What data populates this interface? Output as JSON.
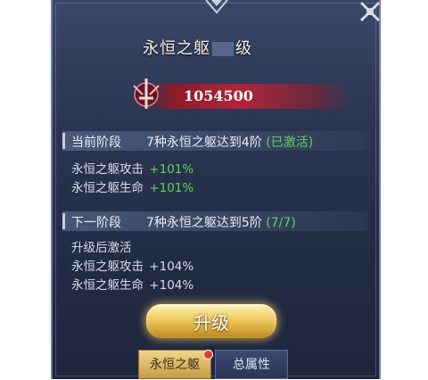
{
  "dialog": {
    "title_left": "永恒之躯",
    "title_right": "级"
  },
  "power": {
    "value": "1054500"
  },
  "current_stage": {
    "label": "当前阶段",
    "desc": "7种永恒之躯达到4阶",
    "status": "(已激活)",
    "stats": [
      {
        "name": "永恒之躯攻击",
        "value": "+101%"
      },
      {
        "name": "永恒之躯生命",
        "value": "+101%"
      }
    ]
  },
  "next_stage": {
    "label": "下一阶段",
    "desc": "7种永恒之躯达到5阶",
    "progress": "(7/7)",
    "note": "升级后激活",
    "stats": [
      {
        "name": "永恒之躯攻击",
        "value": "+104%"
      },
      {
        "name": "永恒之躯生命",
        "value": "+104%"
      }
    ]
  },
  "buttons": {
    "upgrade": "升级"
  },
  "tabs": [
    {
      "label": "永恒之躯",
      "active": true,
      "has_alert": true
    },
    {
      "label": "总属性",
      "active": false,
      "has_alert": false
    }
  ],
  "colors": {
    "accent_green": "#5fd35b",
    "power_bar": "#b0243a",
    "button_gold": "#f0cf6a"
  },
  "icons": {
    "emblem": "sword-emblem-icon",
    "corner": "close-x-icon"
  }
}
